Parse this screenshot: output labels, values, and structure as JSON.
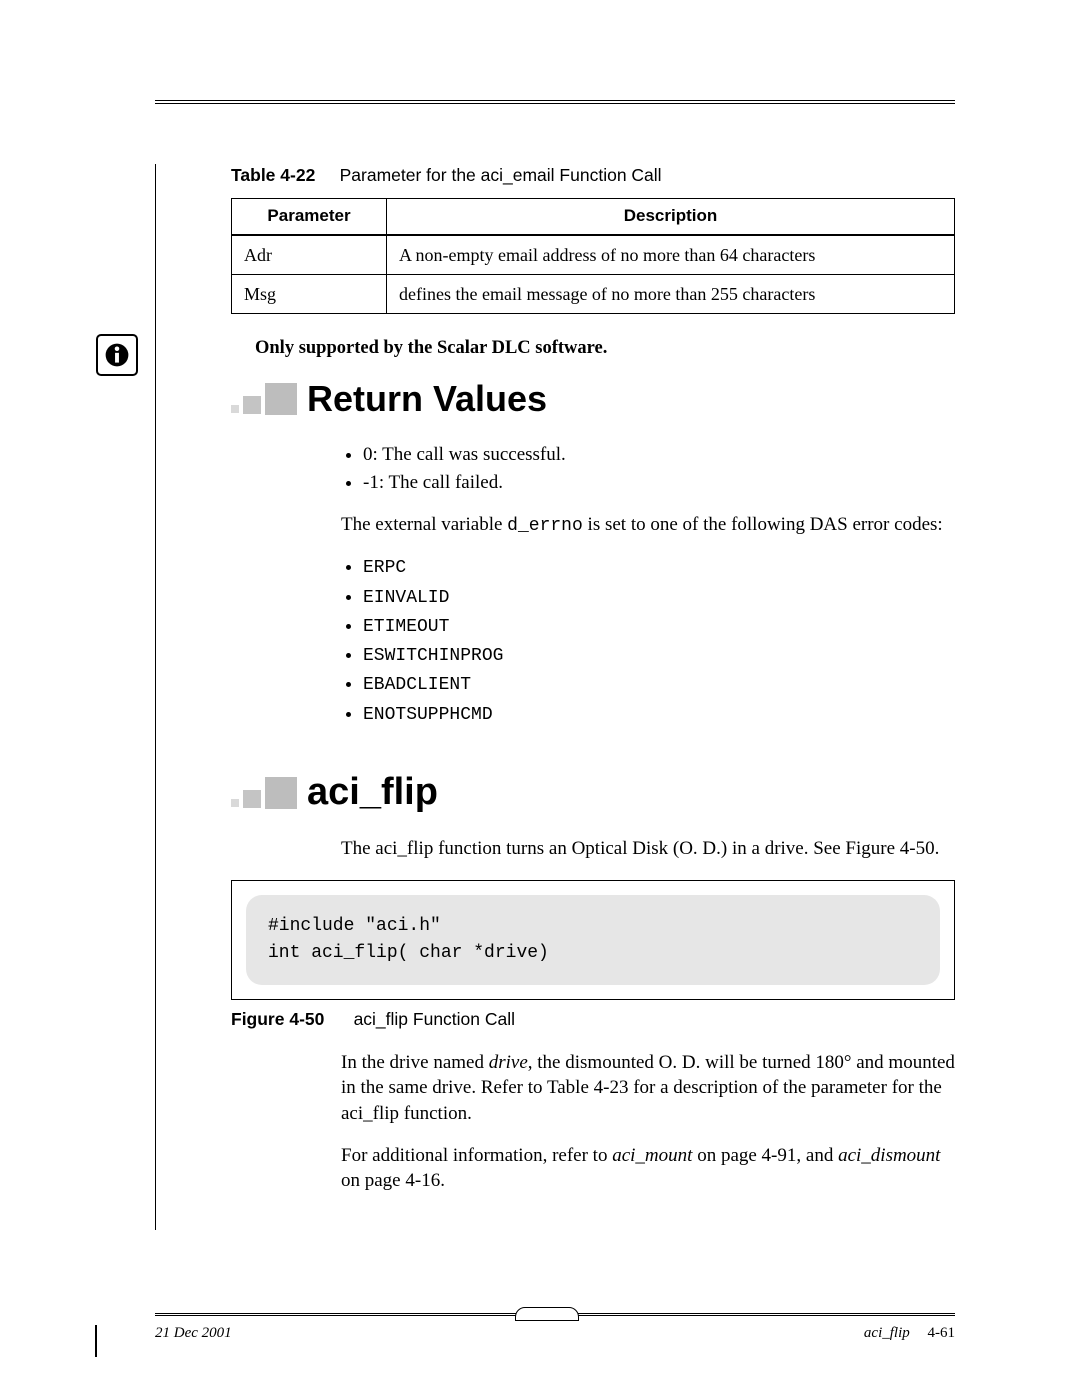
{
  "table": {
    "label": "Table 4-22",
    "caption": "Parameter for the aci_email Function Call",
    "headers": [
      "Parameter",
      "Description"
    ],
    "rows": [
      {
        "p": "Adr",
        "d": "A non-empty email address of no more than 64 characters"
      },
      {
        "p": "Msg",
        "d": "defines the email message of no more than 255 characters"
      }
    ]
  },
  "note": "Only supported by the Scalar DLC software.",
  "sections": {
    "return_values": {
      "title": "Return Values",
      "bullets": [
        "0: The call was successful.",
        "-1: The call failed."
      ],
      "para_pre": "The external variable ",
      "para_code": "d_errno",
      "para_post": " is set to one of the following DAS error codes:",
      "codes": [
        "ERPC",
        "EINVALID",
        "ETIMEOUT",
        "ESWITCHINPROG",
        "EBADCLIENT",
        "ENOTSUPPHCMD"
      ]
    },
    "aci_flip": {
      "title": "aci_flip",
      "intro": "The aci_flip function turns an Optical Disk (O. D.) in a drive. See Figure 4-50.",
      "code": "#include \"aci.h\"\nint aci_flip( char *drive)",
      "figure_label": "Figure 4-50",
      "figure_caption": "aci_flip Function Call",
      "p2_a": "In the drive named ",
      "p2_drive": "drive",
      "p2_b": ", the dismounted O. D. will be turned 180° and mounted in the same drive. Refer to Table 4-23   for a description of the parameter for the aci_flip function.",
      "p3_a": "For additional information, refer to ",
      "p3_i1": "aci_mount",
      "p3_b": "  on page 4-91, and ",
      "p3_i2": "aci_dismount",
      "p3_c": "  on page 4-16."
    }
  },
  "footer": {
    "date": "21 Dec 2001",
    "section": "aci_flip",
    "page": "4-61"
  }
}
